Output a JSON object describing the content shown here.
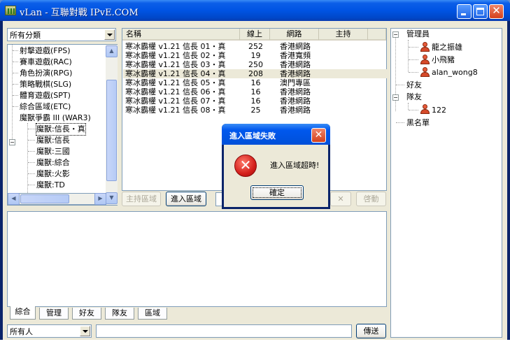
{
  "window": {
    "title": "vLan - 互聯對戰 IPvE.COM",
    "min_icon": "minimize-icon",
    "max_icon": "maximize-icon",
    "close_glyph": "✕"
  },
  "category_combo": {
    "value": "所有分類"
  },
  "category_tree": {
    "items": [
      {
        "label": "射擊遊戲(FPS)"
      },
      {
        "label": "賽車遊戲(RAC)"
      },
      {
        "label": "角色扮演(RPG)"
      },
      {
        "label": "策略戰棋(SLG)"
      },
      {
        "label": "體育遊戲(SPT)"
      },
      {
        "label": "綜合區域(ETC)"
      },
      {
        "label": "魔獸爭霸 III (WAR3)"
      },
      {
        "label": "魔獸:信長・真"
      },
      {
        "label": "魔獸:信長"
      },
      {
        "label": "魔獸:三國"
      },
      {
        "label": "魔獸:綜合"
      },
      {
        "label": "魔獸:火影"
      },
      {
        "label": "魔獸:TD"
      }
    ]
  },
  "room_list": {
    "columns": [
      "名稱",
      "線上",
      "網路",
      "主持"
    ],
    "rows": [
      {
        "name": "寒冰霸權 v1.21  信長 01・真",
        "online": "252",
        "network": "香港網路",
        "host": ""
      },
      {
        "name": "寒冰霸權 v1.21  信長 02・真",
        "online": "19",
        "network": "香港寬頻",
        "host": ""
      },
      {
        "name": "寒冰霸權 v1.21  信長 03・真",
        "online": "250",
        "network": "香港網路",
        "host": ""
      },
      {
        "name": "寒冰霸權 v1.21  信長 04・真",
        "online": "208",
        "network": "香港網路",
        "host": ""
      },
      {
        "name": "寒冰霸權 v1.21  信長 05・真",
        "online": "16",
        "network": "澳門專區",
        "host": ""
      },
      {
        "name": "寒冰霸權 v1.21  信長 06・真",
        "online": "16",
        "network": "香港網路",
        "host": ""
      },
      {
        "name": "寒冰霸權 v1.21  信長 07・真",
        "online": "16",
        "network": "香港網路",
        "host": ""
      },
      {
        "name": "寒冰霸權 v1.21  信長 08・真",
        "online": "25",
        "network": "香港網路",
        "host": ""
      }
    ]
  },
  "room_buttons": {
    "host_zone": "主持區域",
    "enter_zone": "進入區域",
    "cancel_glyph": "✕",
    "start": "啓動"
  },
  "chat_tabs": [
    "綜合",
    "管理",
    "好友",
    "隊友",
    "區域"
  ],
  "chat_target": {
    "value": "所有人"
  },
  "send_button": "傳送",
  "user_tree": {
    "admins_label": "管理員",
    "admins": [
      "龍之振雄",
      "小飛豬",
      "alan_wong8"
    ],
    "friends_label": "好友",
    "teammates_label": "隊友",
    "teammates": [
      "122"
    ],
    "blacklist_label": "黑名單"
  },
  "dialog": {
    "title": "進入區域失敗",
    "message": "進入區域超時!",
    "ok": "確定",
    "error_glyph": "✕",
    "close_glyph": "✕"
  },
  "colors": {
    "titlebar": "#0054e3",
    "dialog_face": "#ece9d8",
    "error_red": "#d4201c"
  }
}
